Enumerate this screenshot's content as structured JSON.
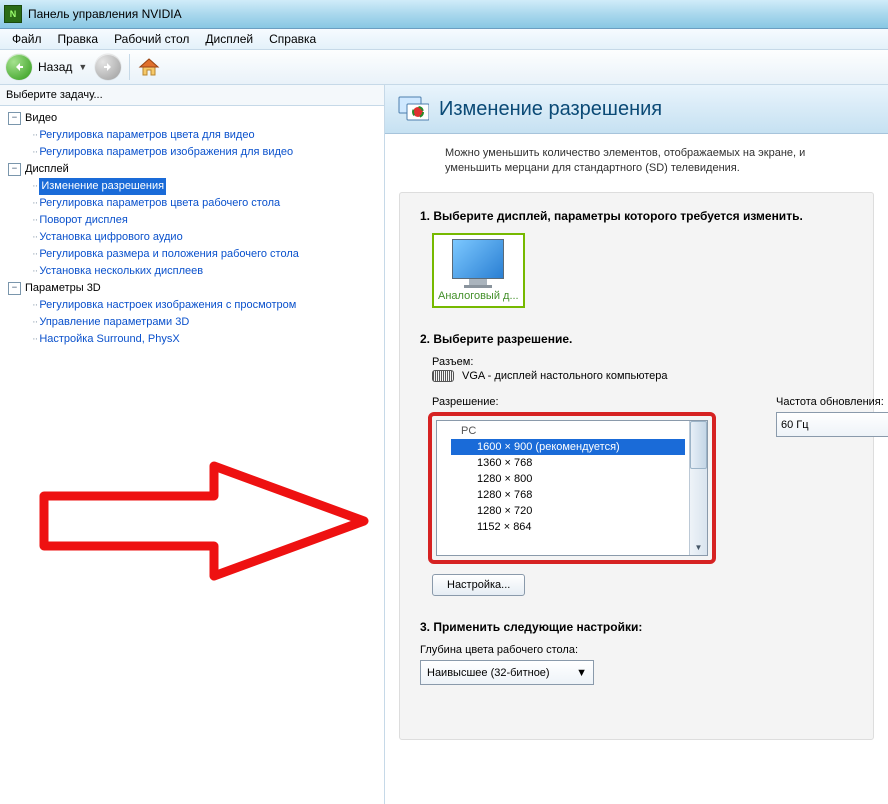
{
  "window": {
    "title": "Панель управления NVIDIA"
  },
  "menu": {
    "file": "Файл",
    "edit": "Правка",
    "desktop": "Рабочий стол",
    "display": "Дисплей",
    "help": "Справка"
  },
  "toolbar": {
    "back": "Назад"
  },
  "left": {
    "task_header": "Выберите задачу...",
    "cat_video": "Видео",
    "video_items": [
      "Регулировка параметров цвета для видео",
      "Регулировка параметров изображения для видео"
    ],
    "cat_display": "Дисплей",
    "display_items": [
      "Изменение разрешения",
      "Регулировка параметров цвета рабочего стола",
      "Поворот дисплея",
      "Установка цифрового аудио",
      "Регулировка размера и положения рабочего стола",
      "Установка нескольких дисплеев"
    ],
    "display_selected_index": 0,
    "cat_3d": "Параметры 3D",
    "threeD_items": [
      "Регулировка настроек изображения с просмотром",
      "Управление параметрами 3D",
      "Настройка Surround, PhysX"
    ]
  },
  "page": {
    "title": "Изменение разрешения",
    "desc": "Можно уменьшить количество элементов, отображаемых на экране, и уменьшить мерцани для стандартного (SD) телевидения.",
    "step1": "1. Выберите дисплей, параметры которого требуется изменить.",
    "monitor_caption": "Аналоговый д...",
    "step2": "2. Выберите разрешение.",
    "connector_label": "Разъем:",
    "connector_value": "VGA - дисплей настольного компьютера",
    "resolution_label": "Разрешение:",
    "refresh_label": "Частота обновления:",
    "refresh_value": "60 Гц",
    "res_group": "PC",
    "resolutions": [
      "1600 × 900 (рекомендуется)",
      "1360 × 768",
      "1280 × 800",
      "1280 × 768",
      "1280 × 720",
      "1152 × 864"
    ],
    "res_selected_index": 0,
    "customize_btn": "Настройка...",
    "step3": "3. Применить следующие настройки:",
    "depth_label": "Глубина цвета рабочего стола:",
    "depth_value": "Наивысшее (32-битное)"
  }
}
